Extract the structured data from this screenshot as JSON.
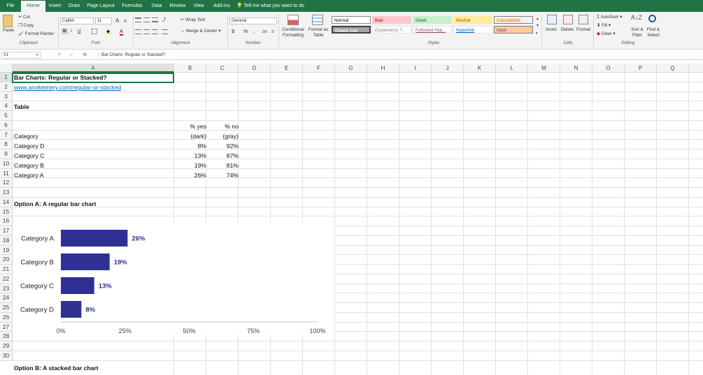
{
  "tabs": [
    "File",
    "Home",
    "Insert",
    "Draw",
    "Page Layout",
    "Formulas",
    "Data",
    "Review",
    "View",
    "Add-ins"
  ],
  "tell_me": "Tell me what you want to do",
  "ribbon": {
    "clipboard": {
      "paste": "Paste",
      "cut": "Cut",
      "copy": "Copy",
      "format_painter": "Format Painter",
      "label": "Clipboard"
    },
    "font": {
      "name": "Calibri",
      "size": "11",
      "bold": "B",
      "italic": "I",
      "underline": "U",
      "grow": "A",
      "shrink": "A",
      "label": "Font"
    },
    "alignment": {
      "wrap": "Wrap Text",
      "merge": "Merge & Center",
      "label": "Alignment"
    },
    "number": {
      "format": "General",
      "currency": "$",
      "percent": "%",
      "comma": ",",
      "label": "Number"
    },
    "styles": {
      "conditional": "Conditional Formatting",
      "format_table": "Format as Table",
      "cells": [
        {
          "text": "Normal",
          "bg": "#ffffff",
          "fg": "#000000"
        },
        {
          "text": "Bad",
          "bg": "#ffc7ce",
          "fg": "#9c0006"
        },
        {
          "text": "Good",
          "bg": "#c6efce",
          "fg": "#006100"
        },
        {
          "text": "Neutral",
          "bg": "#ffeb9c",
          "fg": "#9c5700"
        },
        {
          "text": "Calculation",
          "bg": "#f2f2f2",
          "fg": "#fa7d00"
        },
        {
          "text": "Check Cell",
          "bg": "#a5a5a5",
          "fg": "#ffffff"
        },
        {
          "text": "Explanatory T...",
          "bg": "#ffffff",
          "fg": "#7f7f7f"
        },
        {
          "text": "Followed Hyp...",
          "bg": "#ffffff",
          "fg": "#954f72"
        },
        {
          "text": "Hyperlink",
          "bg": "#ffffff",
          "fg": "#0563c1"
        },
        {
          "text": "Input",
          "bg": "#ffcc99",
          "fg": "#3f3f76"
        }
      ],
      "label": "Styles"
    },
    "cells": {
      "insert": "Insert",
      "delete": "Delete",
      "format": "Format",
      "label": "Cells"
    },
    "editing": {
      "autosum": "AutoSum",
      "fill": "Fill",
      "clear": "Clear",
      "sort": "Sort & Filter",
      "find": "Find & Select",
      "label": "Editing"
    }
  },
  "formula_bar": {
    "name_box": "A1",
    "fx": "fx",
    "content": "Bar Charts: Regular or Stacked?"
  },
  "columns": [
    "A",
    "B",
    "C",
    "D",
    "E",
    "F",
    "G",
    "H",
    "I",
    "J",
    "K",
    "L",
    "M",
    "N",
    "O",
    "P",
    "Q"
  ],
  "rows": [
    "1",
    "2",
    "3",
    "4",
    "5",
    "6",
    "7",
    "8",
    "9",
    "10",
    "11",
    "12",
    "13",
    "14",
    "15",
    "16",
    "17",
    "18",
    "19",
    "20",
    "21",
    "22",
    "23",
    "24",
    "25",
    "26",
    "27",
    "28",
    "29",
    "30"
  ],
  "sheet": {
    "a1": "Bar Charts: Regular or Stacked?",
    "a2": "www.annkemery.com/regular-or-stacked",
    "a4": "Table",
    "b5": "% yes",
    "c5": "% no",
    "a6": "Category",
    "b6": "(dark)",
    "c6": "(gray)",
    "table": [
      {
        "cat": "Category D",
        "yes": "8%",
        "no": "92%"
      },
      {
        "cat": "Category C",
        "yes": "13%",
        "no": "87%"
      },
      {
        "cat": "Category B",
        "yes": "19%",
        "no": "81%"
      },
      {
        "cat": "Category A",
        "yes": "26%",
        "no": "74%"
      }
    ],
    "a13": "Option A: A regular bar chart",
    "a30": "Option B: A stacked bar chart"
  },
  "colors": {
    "accent": "#217346",
    "bar": "#2e3192",
    "link": "#0563c1"
  },
  "chart_data": {
    "type": "bar",
    "orientation": "horizontal",
    "categories": [
      "Category A",
      "Category B",
      "Category C",
      "Category D"
    ],
    "values": [
      26,
      19,
      13,
      8
    ],
    "labels": [
      "26%",
      "19%",
      "13%",
      "8%"
    ],
    "xticks": [
      "0%",
      "25%",
      "50%",
      "75%",
      "100%"
    ],
    "xlim": [
      0,
      100
    ],
    "grid": false
  }
}
